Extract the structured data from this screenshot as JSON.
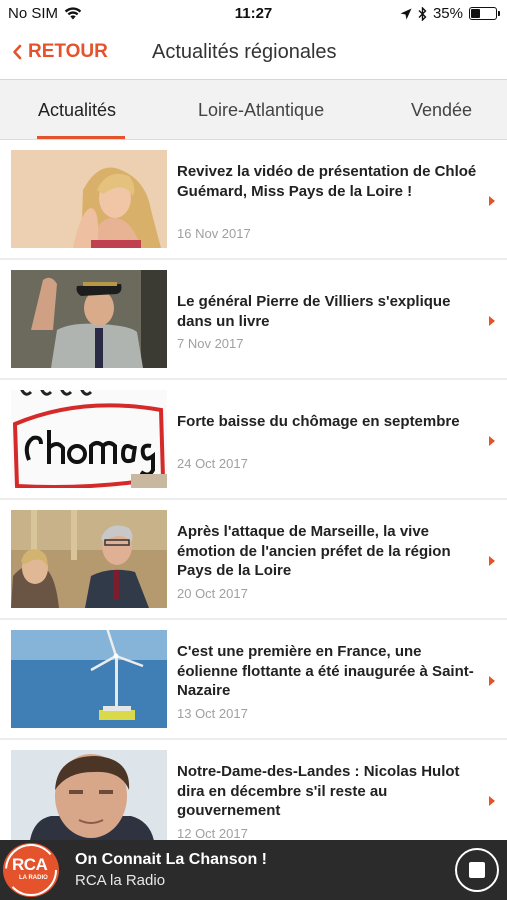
{
  "status_bar": {
    "carrier": "No SIM",
    "time": "11:27",
    "battery": "35%",
    "battery_level": 0.35,
    "icons": [
      "wifi-icon",
      "location-arrow-icon",
      "bluetooth-icon",
      "battery-icon"
    ]
  },
  "nav": {
    "back_label": "RETOUR",
    "title": "Actualités régionales"
  },
  "tabs": [
    {
      "label": "Actualités",
      "active": true
    },
    {
      "label": "Loire-Atlantique",
      "active": false
    },
    {
      "label": "Vendée",
      "active": false
    }
  ],
  "articles": [
    {
      "title": "Revivez la vidéo de présentation de Chloé Guémard, Miss Pays de la Loire !",
      "date": "16 Nov 2017",
      "thumbnail": "portrait-blonde-woman"
    },
    {
      "title": "Le général Pierre de Villiers s'explique dans un livre",
      "date": "7 Nov 2017",
      "thumbnail": "general-saluting"
    },
    {
      "title": "Forte baisse du chômage en septembre",
      "date": "24 Oct 2017",
      "thumbnail": "chomage-notepad"
    },
    {
      "title": "Après l'attaque de Marseille, la vive émotion de l'ancien préfet de la région Pays de la Loire",
      "date": "20 Oct 2017",
      "thumbnail": "ceremony-officials"
    },
    {
      "title": "C'est une première en France, une éolienne flottante a été inaugurée à Saint-Nazaire",
      "date": "13 Oct 2017",
      "thumbnail": "floating-wind-turbine"
    },
    {
      "title": "Notre-Dame-des-Landes : Nicolas Hulot dira en décembre s'il reste au gouvernement",
      "date": "12 Oct 2017",
      "thumbnail": "portrait-man"
    }
  ],
  "player": {
    "logo_text": "RCA",
    "logo_sub": "LA RADIO",
    "track": "On Connait La Chanson !",
    "station": "RCA la Radio"
  },
  "colors": {
    "accent": "#e4532b",
    "player_bg": "#2b2b2b",
    "tab_bg": "#f2f2f2"
  }
}
